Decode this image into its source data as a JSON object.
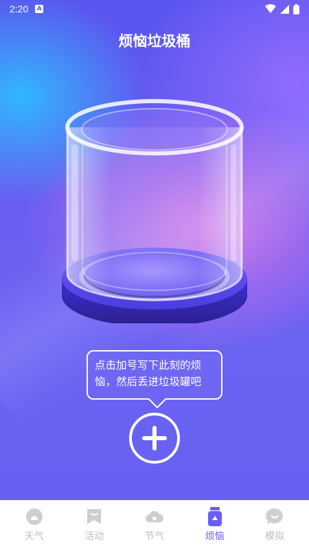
{
  "status_bar": {
    "time": "2:20",
    "notification_glyph": "A"
  },
  "header": {
    "title": "烦恼垃圾桶"
  },
  "tooltip": {
    "text": "点击加号写下此刻的烦恼，然后丢进垃圾罐吧"
  },
  "add_button": {
    "icon": "plus-icon"
  },
  "tabs": [
    {
      "label": "天气",
      "icon": "weather-icon",
      "active": false
    },
    {
      "label": "活动",
      "icon": "bookmark-icon",
      "active": false
    },
    {
      "label": "节气",
      "icon": "cloud-icon",
      "active": false
    },
    {
      "label": "烦恼",
      "icon": "jar-icon",
      "active": true
    },
    {
      "label": "模拟",
      "icon": "chat-icon",
      "active": false
    }
  ],
  "colors": {
    "accent": "#6a5ef2",
    "inactive": "#bdbdbd"
  }
}
